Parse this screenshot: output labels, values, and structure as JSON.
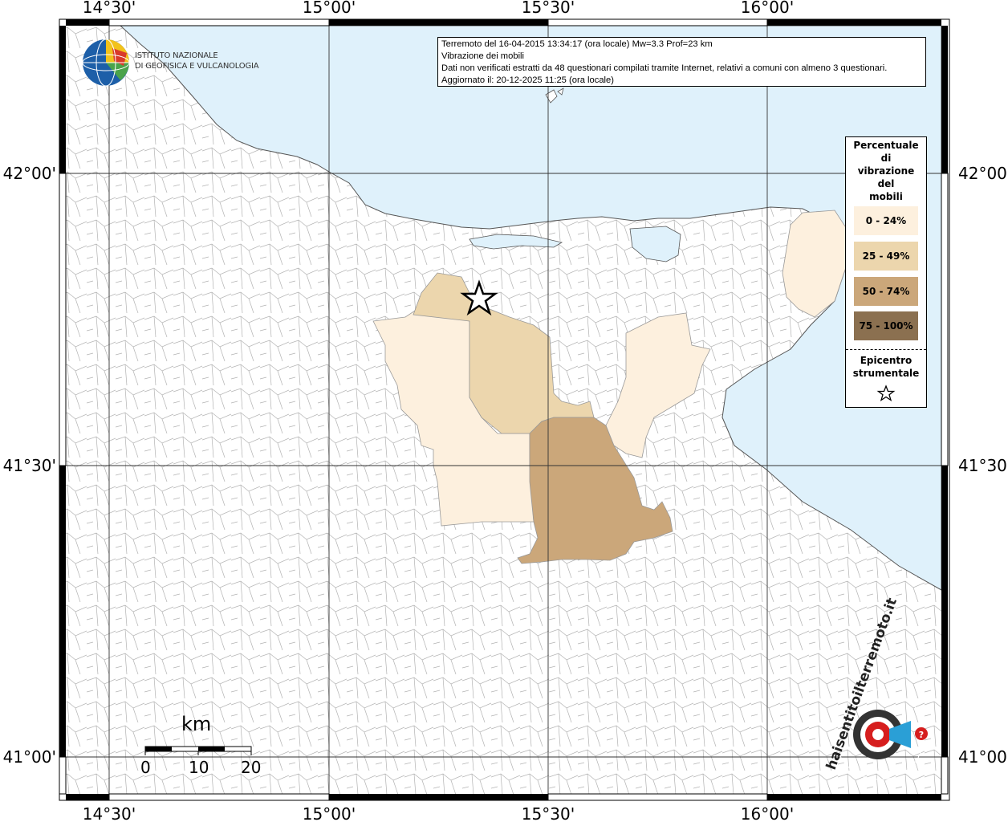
{
  "map": {
    "lon_ticks": [
      "14°30'",
      "15°00'",
      "15°30'",
      "16°00'"
    ],
    "lat_ticks": [
      "42°00'",
      "41°30'",
      "41°00'"
    ],
    "colors": {
      "sea": "#dff1fb",
      "land": "#ffffff",
      "border": "#a0a0a0",
      "class_0_24": "#fdf0de",
      "class_25_49": "#ecd6ad",
      "class_50_74": "#cba77a",
      "class_75_100": "#8b7050"
    }
  },
  "logo": {
    "line1": "ISTITUTO NAZIONALE",
    "line2": "DI GEOFISICA E VULCANOLOGIA"
  },
  "info": {
    "line1": "Terremoto del 16-04-2015 13:34:17 (ora locale) Mw=3.3 Prof=23 km",
    "line2": "Vibrazione dei mobili",
    "line3": "Dati non verificati estratti da 48 questionari compilati tramite Internet, relativi a comuni con almeno 3 questionari.",
    "line4": "Aggiornato il: 20-12-2025 11:25 (ora locale)"
  },
  "legend": {
    "title_lines": [
      "Percentuale",
      "di",
      "vibrazione",
      "del",
      "mobili"
    ],
    "items": [
      {
        "label": "0 - 24%",
        "color": "#fdf0de"
      },
      {
        "label": "25 - 49%",
        "color": "#ecd6ad"
      },
      {
        "label": "50 - 74%",
        "color": "#cba77a"
      },
      {
        "label": "75 - 100%",
        "color": "#8b7050"
      }
    ],
    "epicenter_lines": [
      "Epicentro",
      "strumentale"
    ]
  },
  "scale_bar": {
    "unit": "km",
    "labels": [
      "0",
      "10",
      "20"
    ]
  },
  "watermark": {
    "text": "haisentitoilterremoto.it",
    "icon": "haisentito-logo-icon"
  }
}
